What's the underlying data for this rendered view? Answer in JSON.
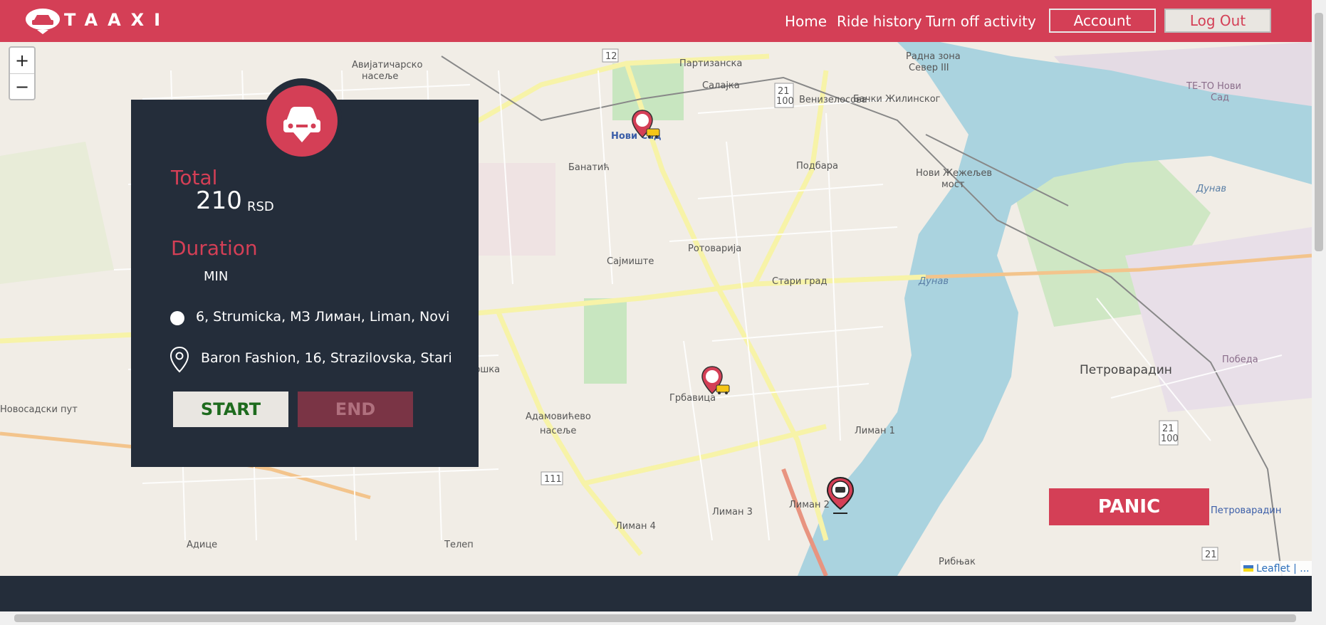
{
  "brand": {
    "logo_text": "TAAXI"
  },
  "nav": {
    "home": "Home",
    "ride_history": "Ride history",
    "turn_off_activity": "Turn off activity",
    "account": "Account",
    "logout": "Log Out"
  },
  "map": {
    "zoom_in": "+",
    "zoom_out": "−",
    "attribution": "Leaflet | ...",
    "labels": {
      "l1": "Авијатичарско",
      "l2": "насеље",
      "l3": "Партизанска",
      "l4": "Салајка",
      "l5": "Радна зона",
      "l6": "Север III",
      "l7": "Венизелосова",
      "l8": "Бачки Жилинског",
      "l9": "Нови Сад",
      "l10": "Банатић",
      "l11": "Подбара",
      "l12": "Нови Жежељев",
      "l13": "мост",
      "l14": "Сајмиште",
      "l15": "Ротоварија",
      "l16": "Стари град",
      "l17": "Петроварадин",
      "l18": "Грбавица",
      "l19": "Футошка",
      "l20": "Адамовићево",
      "l21": "насеље",
      "l22": "Лиман 1",
      "l23": "Лиман 2",
      "l24": "Лиман 3",
      "l25": "Лиман 4",
      "l26": "Адице",
      "l27": "Телеп",
      "l28": "Рибњак",
      "l29": "Петроварадин",
      "l30": "Дунав",
      "l31": "Дунав",
      "l32": "ТЕ-ТО Нови",
      "l33": "Сад",
      "l34": "Победа",
      "l35": "Новосадски пут",
      "r12": "12",
      "r21": "21",
      "r100": "100",
      "r111": "111",
      "r21b": "21",
      "r100b": "100",
      "r21c": "21"
    }
  },
  "ride": {
    "total_label": "Total",
    "total_value": "210",
    "total_currency": "RSD",
    "duration_label": "Duration",
    "duration_value": "",
    "duration_unit": "MIN",
    "start_address": "6, Strumicka, МЗ Лиман, Liman, Novi",
    "end_address": "Baron Fashion, 16, Strazilovska, Stari",
    "start_button": "START",
    "end_button": "END"
  },
  "panic_button": "PANIC",
  "colors": {
    "accent": "#d43f56",
    "panel": "#242d3a",
    "start_text": "#1e6b1e",
    "end_bg": "#7a3445"
  },
  "icons": {
    "car": "car-icon",
    "pin": "pin-icon",
    "start": "start-dot-icon",
    "taxi_marker": "taxi-marker-icon"
  }
}
